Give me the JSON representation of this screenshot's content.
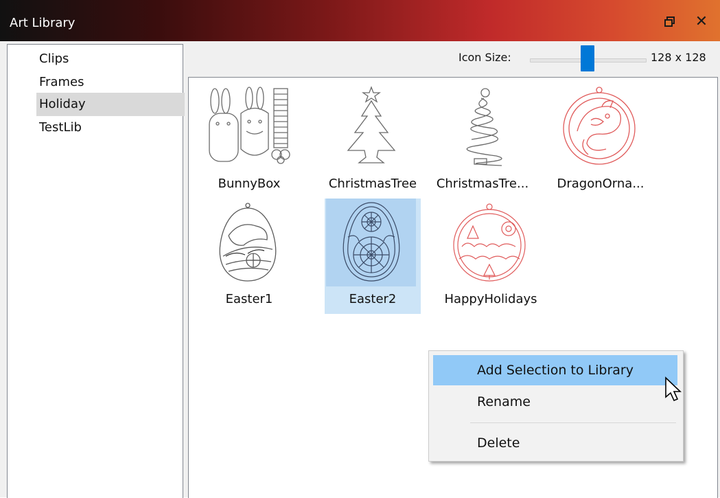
{
  "window": {
    "title": "Art Library",
    "restore_icon": "restore-icon",
    "close_icon": "close-icon",
    "close_glyph": "✕",
    "restore_glyph": "🗗"
  },
  "tree": {
    "items": [
      {
        "label": "Clips",
        "selected": false
      },
      {
        "label": "Frames",
        "selected": false
      },
      {
        "label": "Holiday",
        "selected": true
      },
      {
        "label": "TestLib",
        "selected": false
      }
    ]
  },
  "toolbar": {
    "icon_size_label": "Icon Size:",
    "icon_size_value": "128 x 128"
  },
  "library_items": [
    {
      "label": "BunnyBox",
      "icon": "bunny-box-icon",
      "selected": false
    },
    {
      "label": "ChristmasTree",
      "icon": "christmas-tree-icon",
      "selected": false
    },
    {
      "label": "ChristmasTre...",
      "icon": "spiral-christmas-tree-icon",
      "selected": false
    },
    {
      "label": "DragonOrna...",
      "icon": "dragon-ornament-icon",
      "selected": false
    },
    {
      "label": "Easter1",
      "icon": "easter-egg-bunny-icon",
      "selected": false
    },
    {
      "label": "Easter2",
      "icon": "easter-egg-mandala-icon",
      "selected": true
    },
    {
      "label": "HappyHolidays",
      "icon": "happy-holidays-ornament-icon",
      "selected": false
    }
  ],
  "context_menu": {
    "items": [
      {
        "label": "Add Selection to Library",
        "highlighted": true
      },
      {
        "label": "Rename",
        "highlighted": false
      },
      {
        "label": "Delete",
        "highlighted": false
      }
    ]
  },
  "colors": {
    "selection": "#cce4f7",
    "menu_highlight": "#91c9f7",
    "slider": "#0078d7",
    "ornament_red": "#e05a5a"
  }
}
